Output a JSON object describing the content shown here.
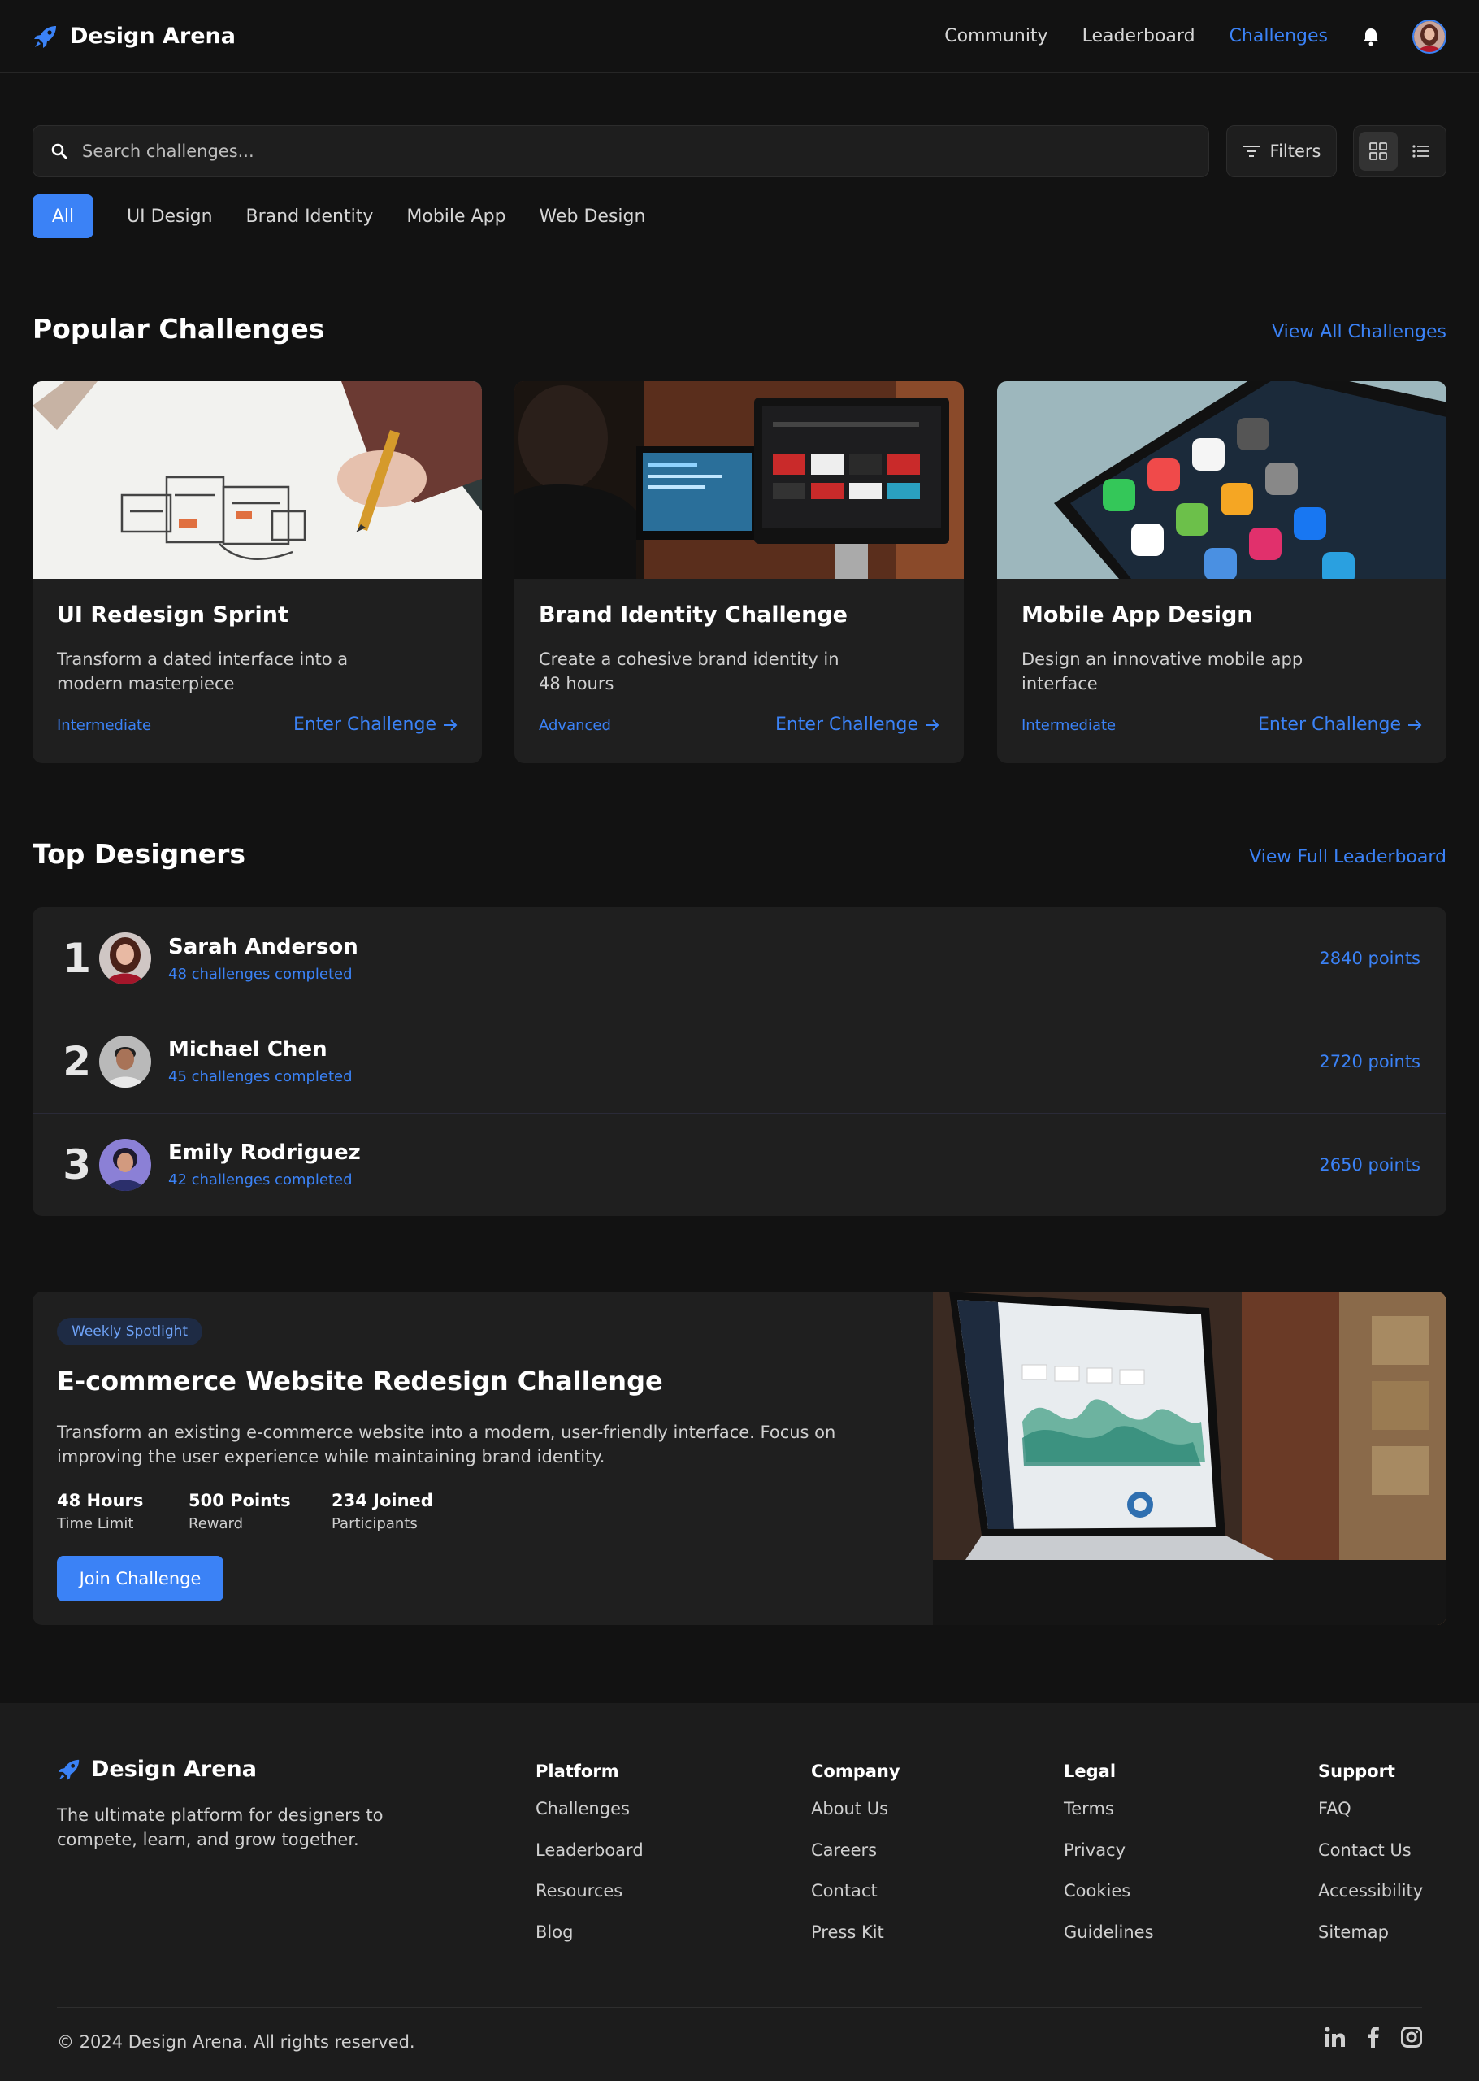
{
  "nav": {
    "brand": "Design Arena",
    "links": [
      "Community",
      "Leaderboard",
      "Challenges"
    ],
    "active_link": "Challenges",
    "icons": [
      "rocket-icon",
      "bell-icon",
      "avatar"
    ]
  },
  "search": {
    "placeholder": "Search challenges...",
    "filters_label": "Filters"
  },
  "categories": [
    "All",
    "UI Design",
    "Brand Identity",
    "Mobile App",
    "Web Design"
  ],
  "popular": {
    "title": "Popular Challenges",
    "view_all": "View All Challenges",
    "cards": [
      {
        "title": "UI Redesign Sprint",
        "desc": "Transform a dated interface into a modern masterpiece",
        "level": "Intermediate",
        "cta": "Enter Challenge"
      },
      {
        "title": "Brand Identity Challenge",
        "desc": "Create a cohesive brand identity in 48 hours",
        "level": "Advanced",
        "cta": "Enter Challenge"
      },
      {
        "title": "Mobile App Design",
        "desc": "Design an innovative mobile app interface",
        "level": "Intermediate",
        "cta": "Enter Challenge"
      }
    ]
  },
  "top": {
    "title": "Top Designers",
    "view_all": "View Full Leaderboard",
    "rows": [
      {
        "rank": "1",
        "name": "Sarah Anderson",
        "sub": "48 challenges completed",
        "points": "2840 points"
      },
      {
        "rank": "2",
        "name": "Michael Chen",
        "sub": "45 challenges completed",
        "points": "2720 points"
      },
      {
        "rank": "3",
        "name": "Emily Rodriguez",
        "sub": "42 challenges completed",
        "points": "2650 points"
      }
    ]
  },
  "spotlight": {
    "badge": "Weekly Spotlight",
    "title": "E-commerce Website Redesign Challenge",
    "desc": "Transform an existing e-commerce website into a modern, user-friendly interface. Focus on improving the user experience while maintaining brand identity.",
    "stats": [
      {
        "value": "48 Hours",
        "label": "Time Limit"
      },
      {
        "value": "500 Points",
        "label": "Reward"
      },
      {
        "value": "234 Joined",
        "label": "Participants"
      }
    ],
    "cta": "Join Challenge"
  },
  "footer": {
    "brand": "Design Arena",
    "tagline": "The ultimate platform for designers to compete, learn, and grow together.",
    "columns": [
      {
        "heading": "Platform",
        "items": [
          "Challenges",
          "Leaderboard",
          "Resources",
          "Blog"
        ]
      },
      {
        "heading": "Company",
        "items": [
          "About Us",
          "Careers",
          "Contact",
          "Press Kit"
        ]
      },
      {
        "heading": "Legal",
        "items": [
          "Terms",
          "Privacy",
          "Cookies",
          "Guidelines"
        ]
      },
      {
        "heading": "Support",
        "items": [
          "FAQ",
          "Contact Us",
          "Accessibility",
          "Sitemap"
        ]
      }
    ],
    "copyright": "© 2024 Design Arena. All rights reserved.",
    "social": [
      "linkedin-icon",
      "facebook-icon",
      "instagram-icon"
    ]
  },
  "colors": {
    "accent": "#3b82f6",
    "background": "#121212",
    "card": "#1f1f1f"
  }
}
